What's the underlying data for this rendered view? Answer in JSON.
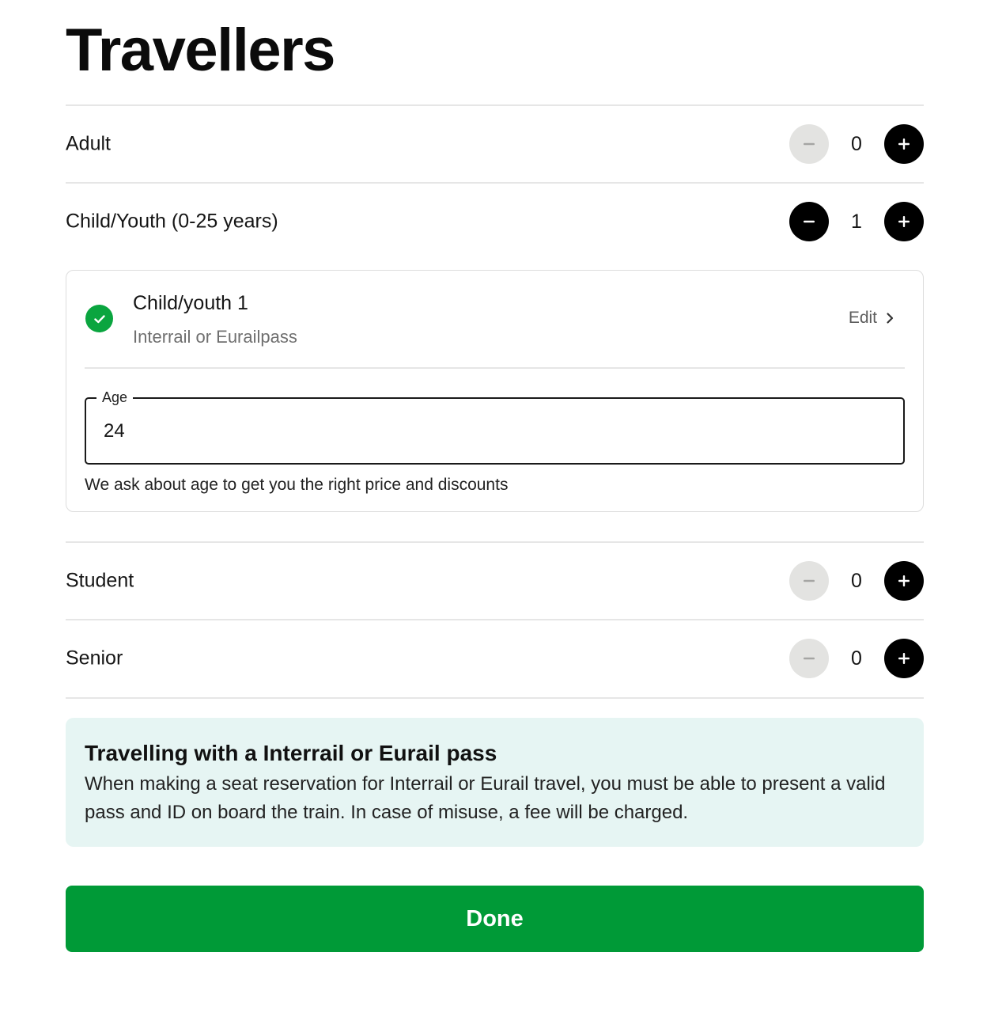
{
  "page": {
    "title": "Travellers"
  },
  "travellers": {
    "adult": {
      "label": "Adult",
      "count": "0",
      "minus_enabled": false
    },
    "child": {
      "label": "Child/Youth (0-25 years)",
      "count": "1",
      "minus_enabled": true
    },
    "student": {
      "label": "Student",
      "count": "0",
      "minus_enabled": false
    },
    "senior": {
      "label": "Senior",
      "count": "0",
      "minus_enabled": false
    }
  },
  "child_card": {
    "name": "Child/youth 1",
    "pass": "Interrail or Eurailpass",
    "edit_label": "Edit",
    "age_label": "Age",
    "age_value": "24",
    "age_help": "We ask about age to get you the right price and discounts"
  },
  "info_box": {
    "title": "Travelling with a Interrail or Eurail pass",
    "text": "When making a seat reservation for Interrail or Eurail travel, you must be able to present a valid pass and ID on board the train. In case of misuse, a fee will be charged."
  },
  "done_label": "Done",
  "icons": {
    "minus": "minus-icon",
    "plus": "plus-icon",
    "check": "check-icon",
    "chevron": "chevron-right-icon"
  },
  "colors": {
    "primary_green": "#009a37",
    "check_green": "#0aa53f",
    "info_bg": "#e6f5f3",
    "disabled_btn": "#e3e3e1",
    "active_btn": "#000000"
  }
}
